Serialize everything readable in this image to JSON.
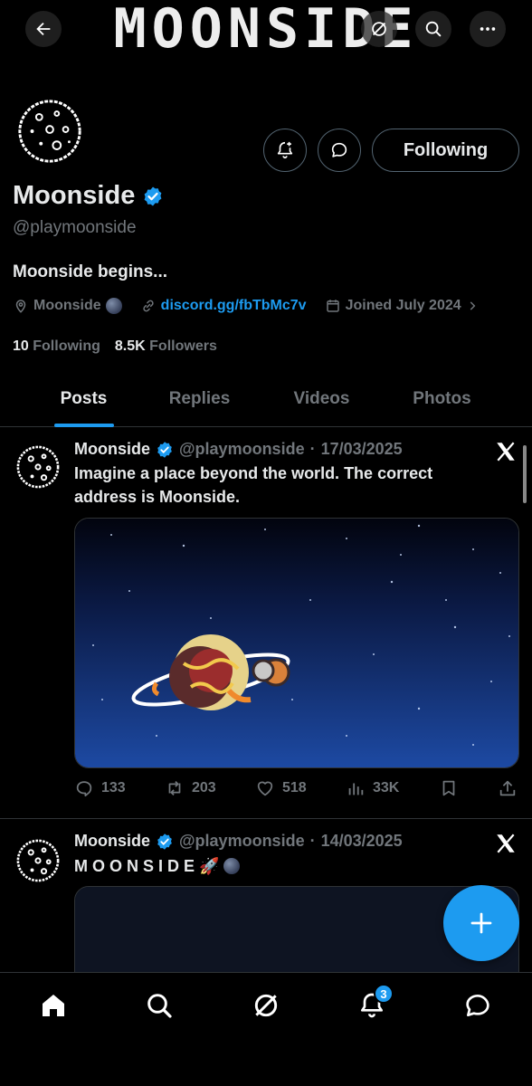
{
  "banner": {
    "text": "MOONSIDE"
  },
  "profile": {
    "name": "Moonside",
    "handle": "@playmoonside",
    "bio": "Moonside begins...",
    "location": "Moonside",
    "website": "discord.gg/fbTbMc7v",
    "joined": "Joined July 2024",
    "following_count": "10",
    "following_label": "Following",
    "followers_count": "8.5K",
    "followers_label": "Followers",
    "follow_button": "Following"
  },
  "tabs": [
    "Posts",
    "Replies",
    "Videos",
    "Photos"
  ],
  "active_tab": "Posts",
  "posts": [
    {
      "name": "Moonside",
      "handle": "@playmoonside",
      "date": "17/03/2025",
      "text": "Imagine a place beyond the world. The correct address is Moonside.",
      "replies": "133",
      "reposts": "203",
      "likes": "518",
      "views": "33K"
    },
    {
      "name": "Moonside",
      "handle": "@playmoonside",
      "date": "14/03/2025",
      "text": "M O O N S I D E 🚀"
    }
  ],
  "notifications_badge": "3",
  "colors": {
    "accent": "#1d9bf0",
    "background": "#000000",
    "text_primary": "#e7e9ea",
    "text_secondary": "#71767b",
    "border": "#2f3336"
  },
  "icons": [
    "back-arrow-icon",
    "grok-icon",
    "search-icon",
    "more-icon",
    "notification-add-icon",
    "message-icon",
    "verified-icon",
    "location-icon",
    "link-icon",
    "calendar-icon",
    "chevron-right-icon",
    "x-logo-icon",
    "reply-icon",
    "repost-icon",
    "like-icon",
    "views-icon",
    "bookmark-icon",
    "share-icon",
    "compose-plus-icon",
    "home-icon",
    "bell-icon"
  ]
}
